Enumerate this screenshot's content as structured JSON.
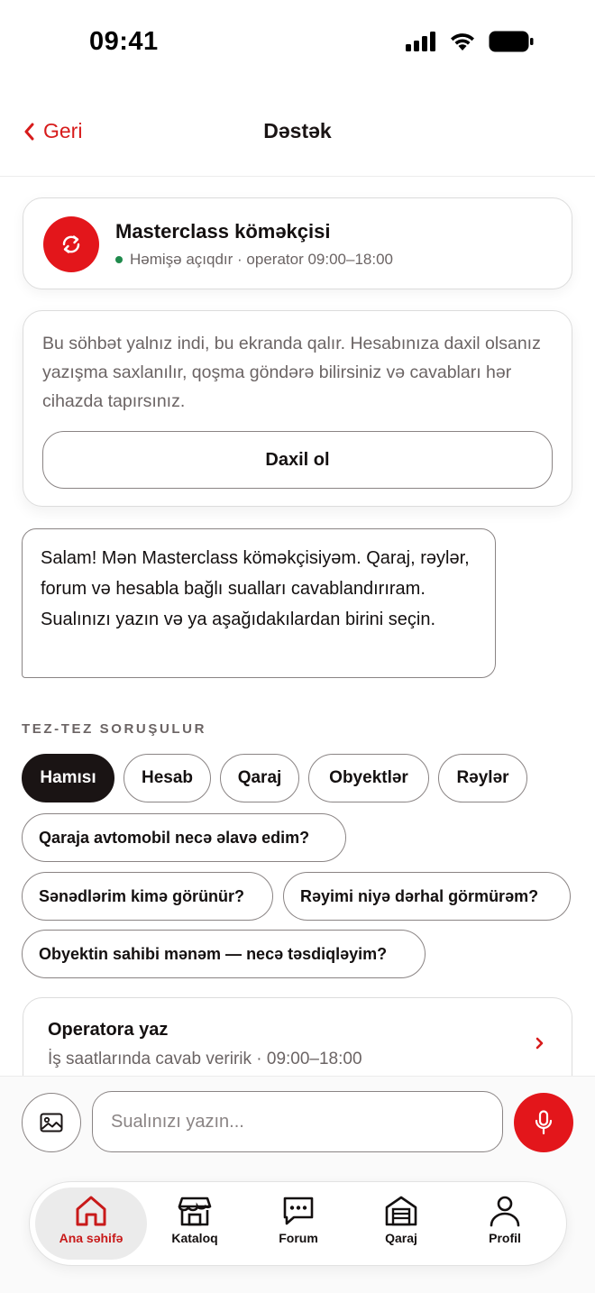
{
  "status_bar": {
    "time": "09:41"
  },
  "nav": {
    "back_label": "Geri",
    "title": "Dəstək"
  },
  "assistant": {
    "name": "Masterclass köməkçisi",
    "status": "Həmişə açıqdır · operator 09:00–18:00",
    "status_color": "#1f8a4c",
    "accent_color": "#e3161b"
  },
  "info": {
    "text": "Bu söhbət yalnız indi, bu ekranda qalır. Hesabınıza daxil olsanız yazışma saxlanılır, qoşma göndərə bilirsiniz və cavabları hər cihazda tapırsınız.",
    "login_label": "Daxil ol"
  },
  "message": {
    "text": "Salam! Mən Masterclass köməkçisiyəm. Qaraj, rəylər, forum və hesabla bağlı sualları cavablandırıram. Sualınızı yazın və ya aşağıdakılardan birini seçin."
  },
  "faq": {
    "title": "TEZ-TEZ SORUŞULUR",
    "filters": [
      "Hamısı",
      "Hesab",
      "Qaraj",
      "Obyektlər",
      "Rəylər"
    ],
    "active_filter": "Hamısı",
    "questions": [
      "Qaraja avtomobil necə əlavə edim?",
      "Sənədlərim kimə görünür?",
      "Rəyimi niyə dərhal görmürəm?",
      "Obyektin sahibi mənəm — necə təsdiqləyim?"
    ]
  },
  "operator": {
    "title": "Operatora yaz",
    "subtitle": "İş saatlarında cavab veririk · 09:00–18:00"
  },
  "composer": {
    "placeholder": "Sualınızı yazın..."
  },
  "tabbar": {
    "items": [
      {
        "label": "Ana səhifə",
        "icon": "home-icon"
      },
      {
        "label": "Kataloq",
        "icon": "store-icon"
      },
      {
        "label": "Forum",
        "icon": "chat-bubble-icon"
      },
      {
        "label": "Qaraj",
        "icon": "garage-icon"
      },
      {
        "label": "Profil",
        "icon": "person-icon"
      }
    ],
    "active": "Ana səhifə"
  }
}
